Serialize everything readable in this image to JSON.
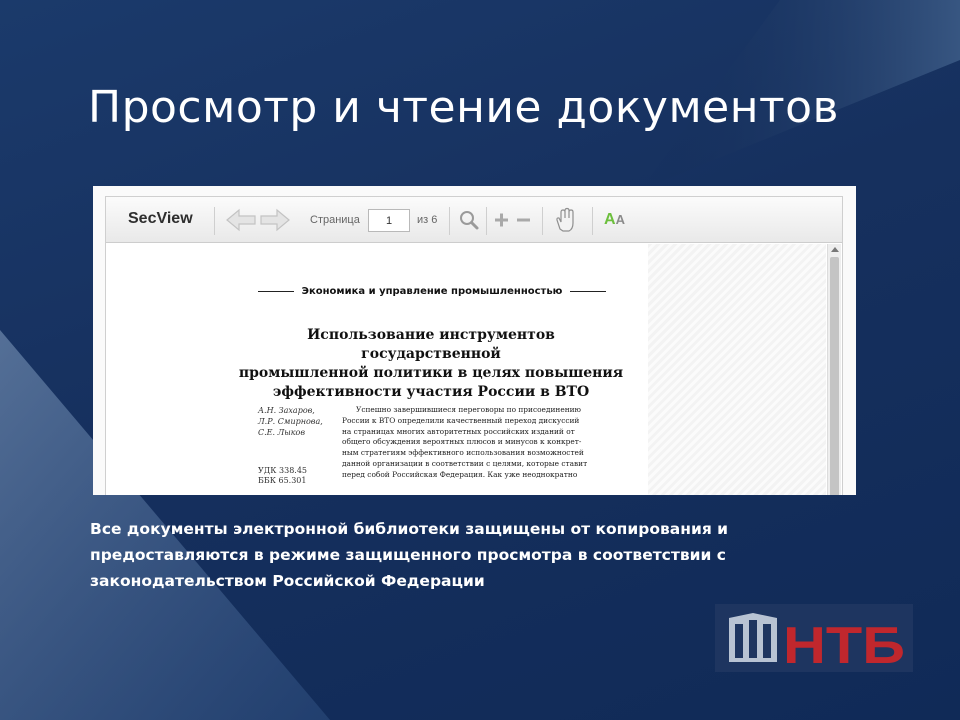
{
  "slide": {
    "title": "Просмотр и чтение документов",
    "caption_lines": [
      "Все документы электронной библиотеки защищены от копирования и",
      "предоставляются в режиме защищенного просмотра в соответствии с",
      "законодательством Российской Федерации"
    ]
  },
  "viewer": {
    "app_name": "SecView",
    "toolbar": {
      "back_icon": "arrow-left-icon",
      "forward_icon": "arrow-right-icon",
      "page_label": "Страница",
      "page_value": "1",
      "of_label": "из 6",
      "zoom_icon": "magnifier-icon",
      "zoom_in_icon": "plus-icon",
      "zoom_out_icon": "minus-icon",
      "pan_icon": "hand-icon",
      "font_toggle_large": "A",
      "font_toggle_small": "A"
    },
    "document": {
      "section": "Экономика и управление промышленностью",
      "title_lines": [
        "Использование инструментов государственной",
        "промышленной политики в целях повышения",
        "эффективности участия России в ВТО"
      ],
      "authors": [
        "А.Н. Захаров,",
        "Л.Р. Смирнова,",
        "С.Е. Лыков"
      ],
      "classification": [
        "УДК 338.45",
        "ББК 65.301"
      ],
      "body_lines": [
        "Успешно завершившиеся переговоры по присоединению",
        "России к ВТО определили качественный переход дискуссий",
        "на страницах многих авторитетных российских изданий от",
        "общего обсуждения вероятных плюсов и минусов к конкрет-",
        "ным стратегиям эффективного использования возможностей",
        "данной организации в соответствии с целями, которые ставит",
        "перед собой Российская Федерация. Как уже неоднократно"
      ]
    }
  },
  "logo": {
    "text": "НТБ",
    "icon": "library-building-icon",
    "color": "#c0272d"
  },
  "colors": {
    "background": "#16305e",
    "text": "#ffffff",
    "accent_green": "#6cbf3d"
  }
}
